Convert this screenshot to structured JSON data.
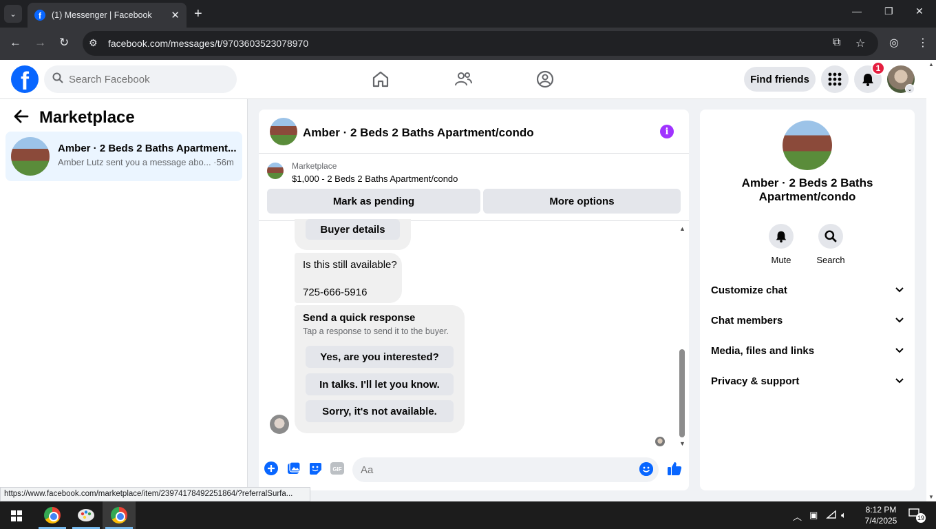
{
  "browser": {
    "tab_title": "(1) Messenger | Facebook",
    "url": "facebook.com/messages/t/9703603523078970",
    "icons": [
      "tab-list-icon",
      "facebook-favicon",
      "close-tab-icon",
      "new-tab-icon",
      "minimize-icon",
      "maximize-icon",
      "close-window-icon",
      "back-icon",
      "forward-icon",
      "reload-icon",
      "site-settings-icon",
      "install-app-icon",
      "bookmark-star-icon",
      "profile-icon",
      "menu-kebab-icon"
    ]
  },
  "fb_header": {
    "search_placeholder": "Search Facebook",
    "find_friends": "Find friends",
    "notification_count": "1",
    "icons": [
      "facebook-logo",
      "search-icon",
      "home-icon",
      "friends-icon",
      "groups-icon",
      "menu-grid-icon",
      "bell-icon",
      "avatar"
    ]
  },
  "sidebar": {
    "title": "Marketplace",
    "conversations": [
      {
        "name": "Amber · 2 Beds 2 Baths Apartment...",
        "snippet": "Amber Lutz sent you a message abo... ·56m"
      }
    ]
  },
  "chat": {
    "title": "Amber · 2 Beds 2 Baths Apartment/condo",
    "banner_label": "Marketplace",
    "listing": "$1,000 - 2 Beds 2 Baths Apartment/condo",
    "mark_pending": "Mark as pending",
    "more_options": "More options",
    "buyer_details": "Buyer details",
    "message_line1": "Is this still available?",
    "message_line2": "725-666-5916",
    "quick_title": "Send a quick response",
    "quick_sub": "Tap a response to send it to the buyer.",
    "quick_responses": [
      "Yes, are you interested?",
      "In talks. I'll let you know.",
      "Sorry, it's not available."
    ],
    "composer_placeholder": "Aa"
  },
  "info_panel": {
    "name_line1": "Amber · 2 Beds 2 Baths",
    "name_line2": "Apartment/condo",
    "mute": "Mute",
    "search": "Search",
    "sections": [
      "Customize chat",
      "Chat members",
      "Media, files and links",
      "Privacy & support"
    ]
  },
  "status_url": "https://www.facebook.com/marketplace/item/23974178492251864/?referralSurfa...",
  "taskbar": {
    "time": "8:12 PM",
    "date": "7/4/2025",
    "notifications": "19"
  },
  "colors": {
    "fb_blue": "#0866ff",
    "selected_conv": "#ebf5ff",
    "info_purple": "#a033ff",
    "badge_red": "#e41e3f"
  }
}
